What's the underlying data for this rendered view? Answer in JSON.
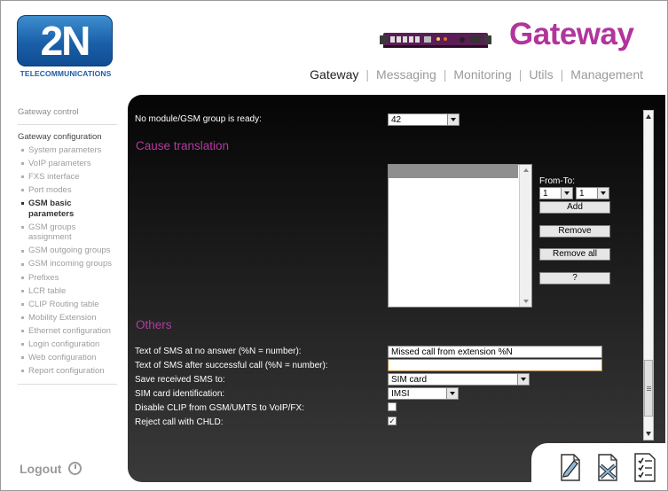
{
  "logo": {
    "text": "2N",
    "subtitle": "TELECOMMUNICATIONS"
  },
  "brand": "Gateway",
  "topnav": [
    "Gateway",
    "Messaging",
    "Monitoring",
    "Utils",
    "Management"
  ],
  "topnav_active": "Gateway",
  "sidebar": {
    "control": "Gateway control",
    "config": "Gateway configuration",
    "items": [
      "System parameters",
      "VoIP parameters",
      "FXS interface",
      "Port modes",
      "GSM basic parameters",
      "GSM groups assignment",
      "GSM outgoing groups",
      "GSM incoming groups",
      "Prefixes",
      "LCR table",
      "CLIP Routing table",
      "Mobility Extension",
      "Ethernet configuration",
      "Login configuration",
      "Web configuration",
      "Report configuration"
    ],
    "current": "GSM basic parameters",
    "logout": "Logout"
  },
  "panel": {
    "no_module_label": "No module/GSM group is ready:",
    "no_module_value": "42",
    "cause_translation_title": "Cause translation",
    "from_to_label": "From-To:",
    "from_value": "1",
    "to_value": "1",
    "buttons": {
      "add": "Add",
      "remove": "Remove",
      "remove_all": "Remove all",
      "help": "?"
    },
    "others_title": "Others",
    "sms_no_answer_label": "Text of SMS at no answer (%N = number):",
    "sms_no_answer_value": "Missed call from extension %N",
    "sms_after_call_label": "Text of SMS after successful call (%N = number):",
    "sms_after_call_value": "",
    "save_sms_label": "Save received SMS to:",
    "save_sms_value": "SIM card",
    "sim_id_label": "SIM card identification:",
    "sim_id_value": "IMSI",
    "disable_clip_label": "Disable CLIP from GSM/UMTS to VoIP/FX:",
    "disable_clip_checked": false,
    "reject_chld_label": "Reject call with CHLD:",
    "reject_chld_checked": true
  },
  "tools": [
    "edit-icon",
    "delete-icon",
    "checklist-icon"
  ],
  "colors": {
    "brand": "#b1359c",
    "section": "#b43aa1",
    "logo_blue": "#1a5fa8"
  }
}
